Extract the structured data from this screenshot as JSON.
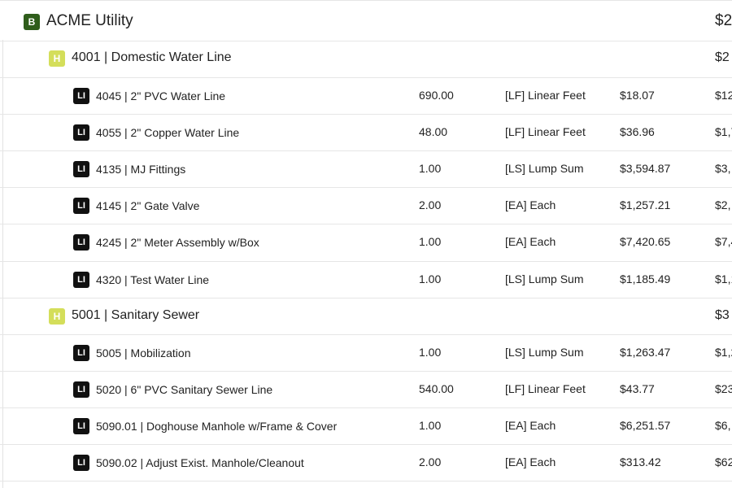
{
  "bid": {
    "badge": "B",
    "name": "ACME Utility",
    "amount": "$2"
  },
  "headers": [
    {
      "badge": "H",
      "name": "4001 | Domestic Water Line",
      "amount": "$2",
      "items": [
        {
          "badge": "LI",
          "name": "4045 | 2\" PVC Water Line",
          "qty": "690.00",
          "unit": "[LF] Linear Feet",
          "price": "$18.07",
          "total": "$12"
        },
        {
          "badge": "LI",
          "name": "4055 | 2\" Copper Water Line",
          "qty": "48.00",
          "unit": "[LF] Linear Feet",
          "price": "$36.96",
          "total": "$1,7"
        },
        {
          "badge": "LI",
          "name": "4135 | MJ Fittings",
          "qty": "1.00",
          "unit": "[LS] Lump Sum",
          "price": "$3,594.87",
          "total": "$3,"
        },
        {
          "badge": "LI",
          "name": "4145 | 2\" Gate Valve",
          "qty": "2.00",
          "unit": "[EA] Each",
          "price": "$1,257.21",
          "total": "$2,"
        },
        {
          "badge": "LI",
          "name": "4245 | 2\" Meter Assembly w/Box",
          "qty": "1.00",
          "unit": "[EA] Each",
          "price": "$7,420.65",
          "total": "$7,4"
        },
        {
          "badge": "LI",
          "name": "4320 | Test Water Line",
          "qty": "1.00",
          "unit": "[LS] Lump Sum",
          "price": "$1,185.49",
          "total": "$1,1"
        }
      ]
    },
    {
      "badge": "H",
      "name": "5001 | Sanitary Sewer",
      "amount": "$3",
      "items": [
        {
          "badge": "LI",
          "name": "5005 | Mobilization",
          "qty": "1.00",
          "unit": "[LS] Lump Sum",
          "price": "$1,263.47",
          "total": "$1,2"
        },
        {
          "badge": "LI",
          "name": "5020 | 6\" PVC Sanitary Sewer Line",
          "qty": "540.00",
          "unit": "[LF] Linear Feet",
          "price": "$43.77",
          "total": "$23"
        },
        {
          "badge": "LI",
          "name": "5090.01 | Doghouse Manhole w/Frame & Cover",
          "qty": "1.00",
          "unit": "[EA] Each",
          "price": "$6,251.57",
          "total": "$6,"
        },
        {
          "badge": "LI",
          "name": "5090.02 | Adjust Exist. Manhole/Cleanout",
          "qty": "2.00",
          "unit": "[EA] Each",
          "price": "$313.42",
          "total": "$62"
        }
      ]
    }
  ]
}
